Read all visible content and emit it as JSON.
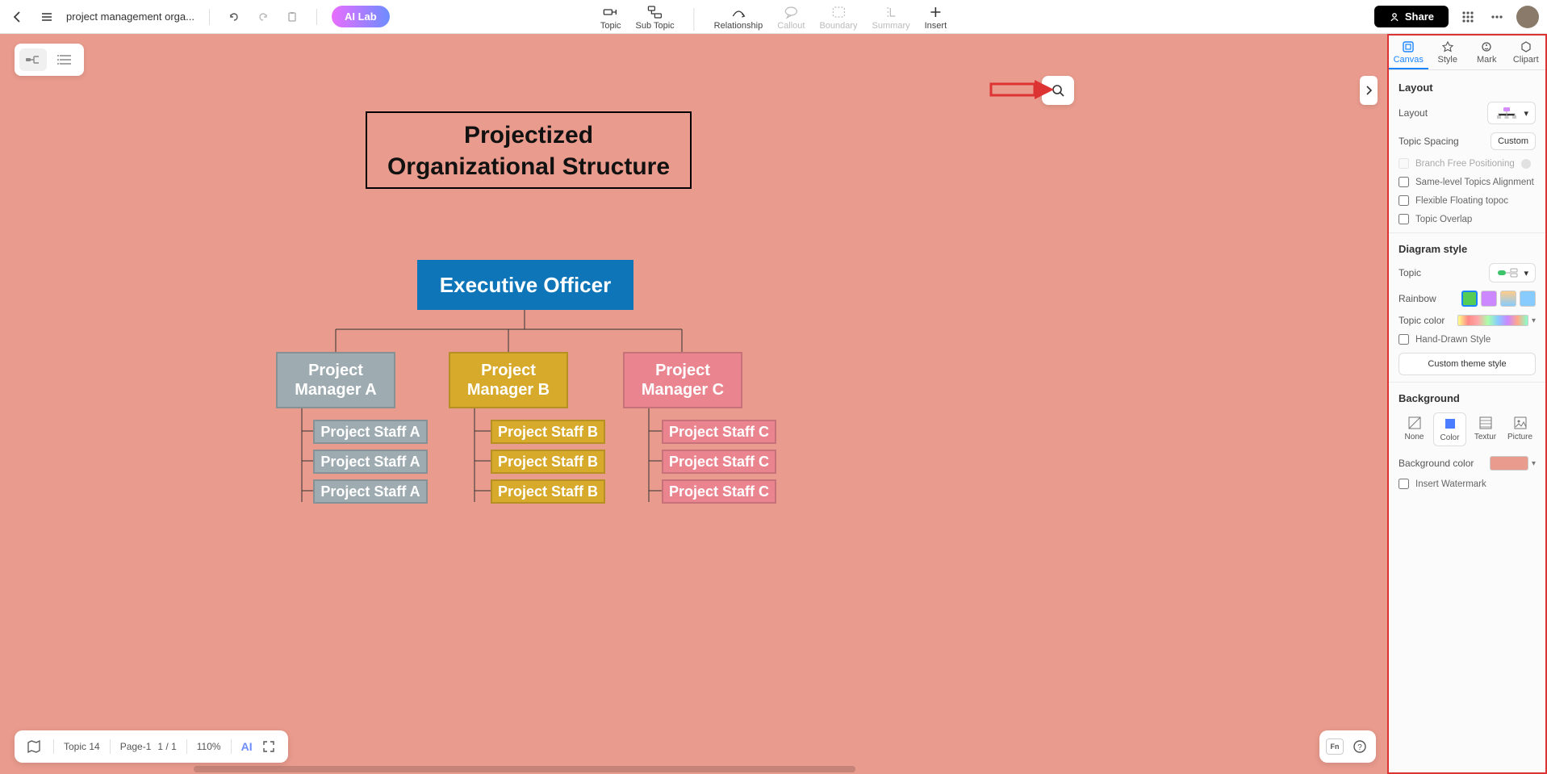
{
  "topbar": {
    "doc_title": "project management orga...",
    "ai_lab": "AI Lab",
    "share": "Share",
    "tools": {
      "topic": "Topic",
      "subtopic": "Sub Topic",
      "relationship": "Relationship",
      "callout": "Callout",
      "boundary": "Boundary",
      "summary": "Summary",
      "insert": "Insert"
    }
  },
  "diagram": {
    "title": "Projectized\nOrganizational Structure",
    "exec": "Executive Officer",
    "pm_a": "Project Manager A",
    "pm_b": "Project Manager B",
    "pm_c": "Project Manager C",
    "staff_a": [
      "Project Staff A",
      "Project Staff A",
      "Project Staff A"
    ],
    "staff_b": [
      "Project Staff B",
      "Project Staff B",
      "Project Staff B"
    ],
    "staff_c": [
      "Project Staff C",
      "Project Staff C",
      "Project Staff C"
    ],
    "colors": {
      "bg": "#e99b8d",
      "exec": "#0d75b8",
      "a": "#9eabb1",
      "b": "#d8aa2b",
      "c": "#ea8590"
    }
  },
  "panel": {
    "tabs": {
      "canvas": "Canvas",
      "style": "Style",
      "mark": "Mark",
      "clipart": "Clipart"
    },
    "layout": {
      "heading": "Layout",
      "layout_label": "Layout",
      "spacing_label": "Topic Spacing",
      "spacing_value": "Custom",
      "branch_free": "Branch Free Positioning",
      "same_level": "Same-level Topics Alignment",
      "flexible_floating": "Flexible Floating topoc",
      "overlap": "Topic Overlap"
    },
    "diagram_style": {
      "heading": "Diagram style",
      "topic": "Topic",
      "rainbow": "Rainbow",
      "topic_color": "Topic color",
      "hand_drawn": "Hand-Drawn Style",
      "custom_theme": "Custom theme style"
    },
    "background": {
      "heading": "Background",
      "none": "None",
      "color": "Color",
      "texture": "Textur",
      "picture": "Picture",
      "bg_color_label": "Background color",
      "bg_color_value": "#e99b8d",
      "watermark": "Insert Watermark"
    }
  },
  "bottombar": {
    "topic_count": "Topic 14",
    "page_label": "Page-1",
    "page_nums": "1 / 1",
    "zoom": "110%",
    "ai": "AI"
  }
}
